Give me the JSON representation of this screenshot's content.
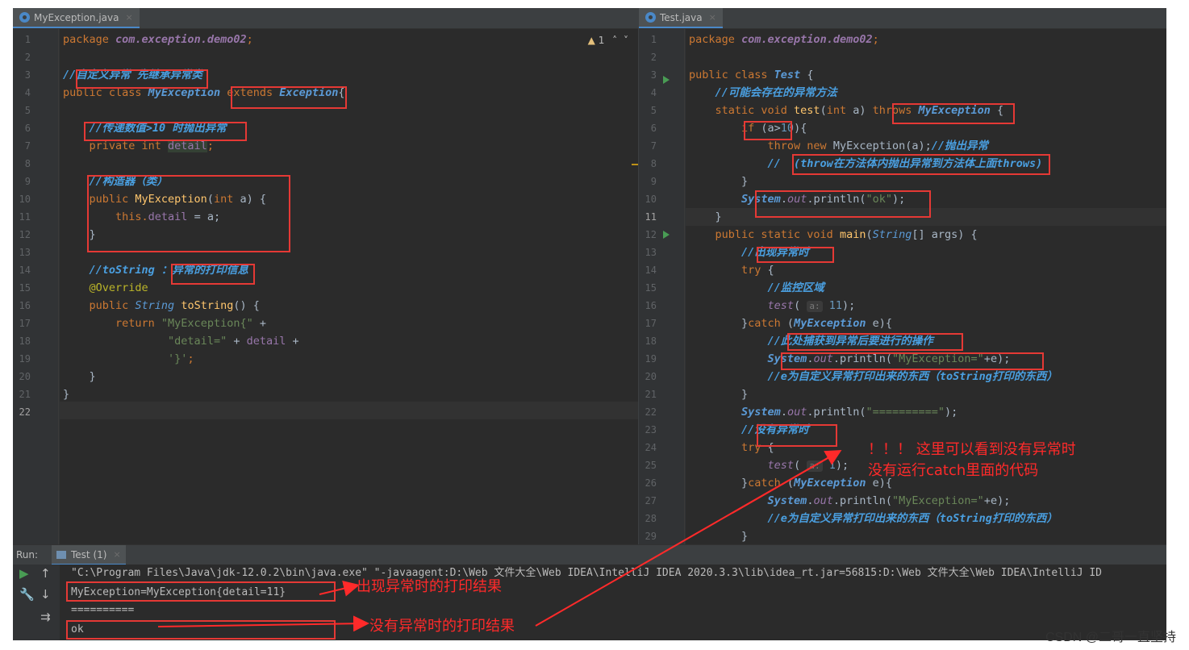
{
  "left_tab": {
    "title": "MyException.java",
    "close": "×"
  },
  "right_tab": {
    "title": "Test.java",
    "close": "×"
  },
  "warning": {
    "icon": "▲",
    "count": "1",
    "up": "˄",
    "down": "˅"
  },
  "left_lines": [
    "1",
    "2",
    "3",
    "4",
    "5",
    "6",
    "7",
    "8",
    "9",
    "10",
    "11",
    "12",
    "13",
    "14",
    "15",
    "16",
    "17",
    "18",
    "19",
    "20",
    "21",
    "22"
  ],
  "right_lines": [
    "1",
    "2",
    "3",
    "4",
    "5",
    "6",
    "7",
    "8",
    "9",
    "10",
    "11",
    "12",
    "13",
    "14",
    "15",
    "16",
    "17",
    "18",
    "19",
    "20",
    "21",
    "22",
    "23",
    "24",
    "25",
    "26",
    "27",
    "28",
    "29"
  ],
  "left_code": {
    "l1_a": "package ",
    "l1_b": "com.exception.demo02",
    "l1_c": ";",
    "l3": "//自定义异常 先继承异常类",
    "l4_a": "public class ",
    "l4_b": "MyException",
    "l4_c": " extends ",
    "l4_d": "Exception",
    "l4_e": "{",
    "l6": "    //传递数值>10 时抛出异常",
    "l7_a": "    private int ",
    "l7_b": "detail",
    "l7_c": ";",
    "l9": "    //构造器（类）",
    "l10_a": "    public ",
    "l10_b": "MyException",
    "l10_c": "(",
    "l10_d": "int",
    "l10_e": " a) {",
    "l11_a": "        this.",
    "l11_b": "detail",
    "l11_c": " = a;",
    "l12": "    }",
    "l14_a": "    //toString ：",
    "l14_b": "异常的打印信息",
    "l15": "    @Override",
    "l16_a": "    public ",
    "l16_b": "String",
    "l16_c": " ",
    "l16_d": "toString",
    "l16_e": "() {",
    "l17_a": "        return ",
    "l17_b": "\"MyException{\"",
    "l17_c": " +",
    "l18_a": "                ",
    "l18_b": "\"detail=\"",
    "l18_c": " + ",
    "l18_d": "detail",
    "l18_e": " +",
    "l19_a": "                ",
    "l19_b": "'}'",
    "l19_c": ";",
    "l20": "    }",
    "l21": "}"
  },
  "right_code": {
    "l1_a": "package ",
    "l1_b": "com.exception.demo02",
    "l1_c": ";",
    "l3_a": "public class ",
    "l3_b": "Test",
    "l3_c": " {",
    "l4": "    //可能会存在的异常方法",
    "l5_a": "    static void ",
    "l5_b": "test",
    "l5_c": "(",
    "l5_d": "int",
    "l5_e": " a) ",
    "l5_f": "throws ",
    "l5_g": "MyException",
    "l5_h": " {",
    "l6_a": "        if ",
    "l6_b": "(a>",
    "l6_c": "10",
    "l6_d": "){",
    "l7_a": "            throw new ",
    "l7_b": "MyException(a);",
    "l7_c": "//抛出异常",
    "l8": "            //  (throw在方法体内抛出异常到方法体上面throws)",
    "l9": "        }",
    "l10_a": "        ",
    "l10_b": "System",
    "l10_c": ".",
    "l10_d": "out",
    "l10_e": ".println(",
    "l10_f": "\"ok\"",
    "l10_g": ");",
    "l11": "    }",
    "l12_a": "    public static void ",
    "l12_b": "main",
    "l12_c": "(",
    "l12_d": "String",
    "l12_e": "[] args) {",
    "l13": "        //出现异常时",
    "l14_a": "        try",
    "l14_b": " {",
    "l15": "            //监控区域",
    "l16_a": "            ",
    "l16_b": "test",
    "l16_c": "( ",
    "l16_hint": "a:",
    "l16_d": " ",
    "l16_e": "11",
    "l16_f": ");",
    "l17_a": "        }",
    "l17_b": "catch",
    "l17_c": " (",
    "l17_d": "MyException",
    "l17_e": " e){",
    "l18": "            //此处捕获到异常后要进行的操作",
    "l19_a": "            ",
    "l19_b": "System",
    "l19_c": ".",
    "l19_d": "out",
    "l19_e": ".println(",
    "l19_f": "\"MyException=\"",
    "l19_g": "+e);",
    "l20": "            //e为自定义异常打印出来的东西（toString打印的东西）",
    "l21": "        }",
    "l22_a": "        ",
    "l22_b": "System",
    "l22_c": ".",
    "l22_d": "out",
    "l22_e": ".println(",
    "l22_f": "\"==========\"",
    "l22_g": ");",
    "l23": "        //没有异常时",
    "l24_a": "        try",
    "l24_b": " {",
    "l25_a": "            ",
    "l25_b": "test",
    "l25_c": "( ",
    "l25_hint": "a:",
    "l25_d": " ",
    "l25_e": "1",
    "l25_f": ");",
    "l26_a": "        }",
    "l26_b": "catch",
    "l26_c": " (",
    "l26_d": "MyException",
    "l26_e": " e){",
    "l27_a": "            ",
    "l27_b": "System",
    "l27_c": ".",
    "l27_d": "out",
    "l27_e": ".println(",
    "l27_f": "\"MyException=\"",
    "l27_g": "+e);",
    "l28": "            //e为自定义异常打印出来的东西（toString打印的东西）",
    "l29": "        }"
  },
  "run": {
    "label": "Run:",
    "tab": "Test (1)",
    "close": "×"
  },
  "console": {
    "line1": "\"C:\\Program Files\\Java\\jdk-12.0.2\\bin\\java.exe\" \"-javaagent:D:\\Web 文件大全\\Web IDEA\\IntelliJ IDEA 2020.3.3\\lib\\idea_rt.jar=56815:D:\\Web 文件大全\\Web IDEA\\IntelliJ ID",
    "line2": "MyException=MyException{detail=11}",
    "line3": "==========",
    "line4": "ok"
  },
  "annotations": {
    "a1": "出现异常时的打印结果",
    "a2": "没有异常时的打印结果",
    "a3_l1": "！！！ 这里可以看到没有异常时",
    "a3_l2": "没有运行catch里面的代码"
  },
  "watermark": "CSDN @二哥一直坚持",
  "colors": {
    "background": "#2b2b2b",
    "keyword": "#cc7832",
    "comment": "#4a9fe0",
    "string": "#6a8759",
    "annotation_red": "#e53935"
  }
}
